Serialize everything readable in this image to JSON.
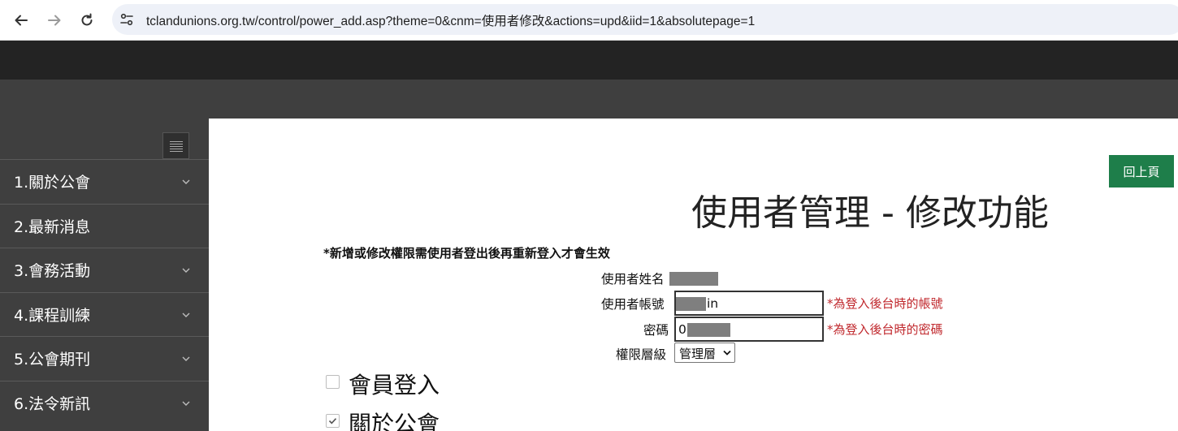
{
  "browser": {
    "url": "tclandunions.org.tw/control/power_add.asp?theme=0&cnm=使用者修改&actions=upd&iid=1&absolutepage=1"
  },
  "sidebar": {
    "items": [
      {
        "label": "1.關於公會",
        "has_children": true
      },
      {
        "label": "2.最新消息",
        "has_children": false
      },
      {
        "label": "3.會務活動",
        "has_children": true
      },
      {
        "label": "4.課程訓練",
        "has_children": true
      },
      {
        "label": "5.公會期刊",
        "has_children": true
      },
      {
        "label": "6.法令新訊",
        "has_children": true
      }
    ]
  },
  "main": {
    "back_label": "回上頁",
    "title": "使用者管理 - 修改功能",
    "notice": "*新增或修改權限需使用者登出後再重新登入才會生效",
    "form": {
      "name_label": "使用者姓名",
      "account_label": "使用者帳號",
      "account_value_visible": "in",
      "account_hint": "*為登入後台時的帳號",
      "password_label": "密碼",
      "password_value_visible": "0",
      "password_hint": "*為登入後台時的密碼",
      "level_label": "權限層級",
      "level_value": "管理層"
    },
    "permissions": [
      {
        "label": "會員登入",
        "checked": false
      },
      {
        "label": "關於公會",
        "checked": true
      }
    ]
  },
  "colors": {
    "topbar": "#232323",
    "subbar": "#3f3f3f",
    "back_button": "#1e7e4a",
    "hint_red": "#c0282d",
    "redaction": "#7f7f7f"
  }
}
